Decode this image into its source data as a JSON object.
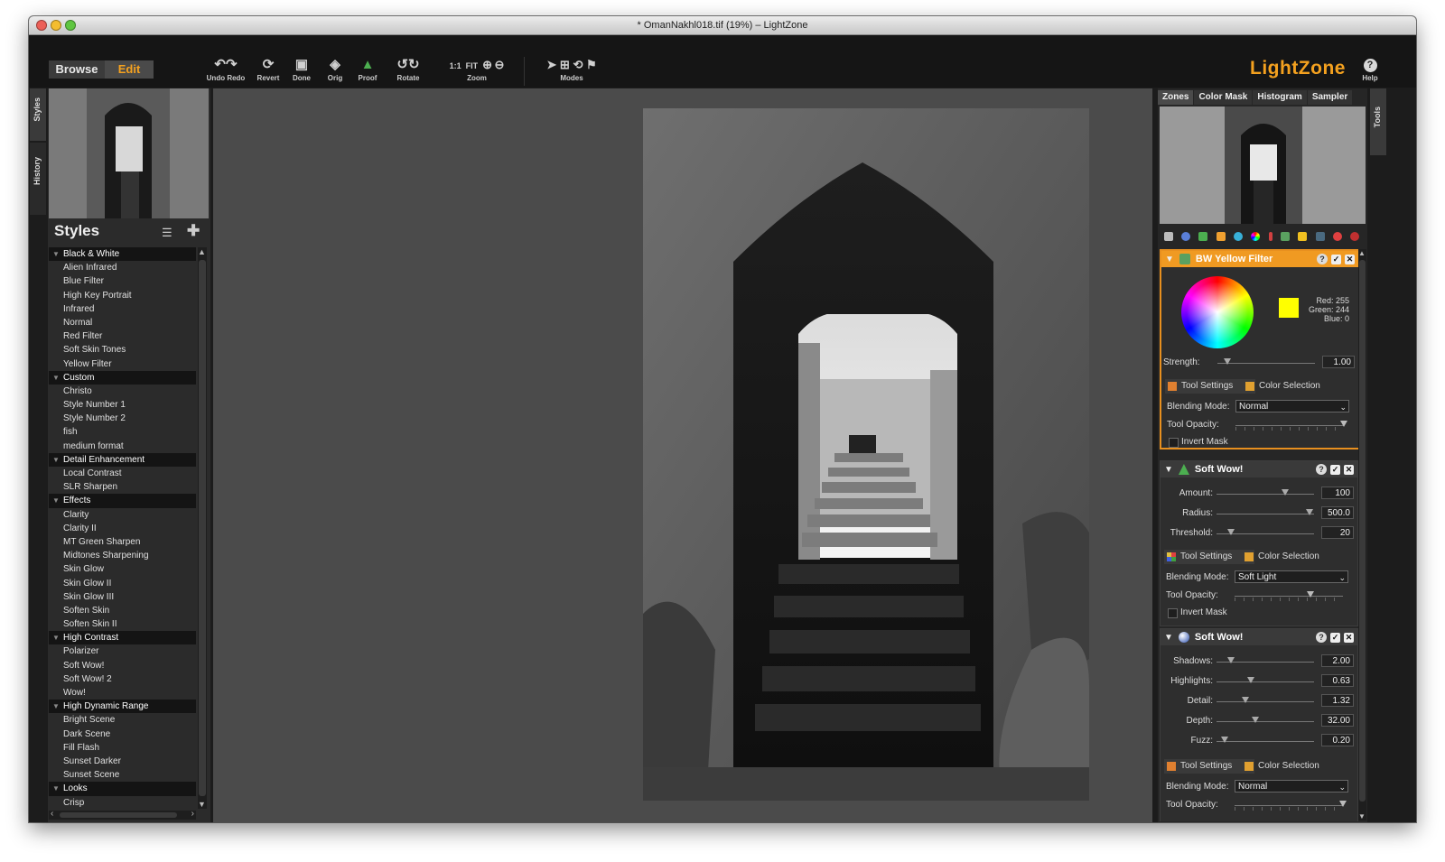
{
  "window": {
    "title": "* OmanNakhl018.tif (19%) – LightZone"
  },
  "toolbar": {
    "browse_label": "Browse",
    "edit_label": "Edit",
    "undo_redo_label": "Undo Redo",
    "revert_label": "Revert",
    "done_label": "Done",
    "orig_label": "Orig",
    "proof_label": "Proof",
    "rotate_label": "Rotate",
    "zoom_label": "Zoom",
    "zoom_1to1": "1:1",
    "zoom_fit": "FIT",
    "modes_label": "Modes",
    "logo": "LightZone",
    "help_label": "Help"
  },
  "left_tabs": {
    "styles": "Styles",
    "history": "History"
  },
  "right_tabs": {
    "tools": "Tools"
  },
  "styles_panel": {
    "title": "Styles",
    "items": [
      {
        "label": "Black & White",
        "group": true
      },
      {
        "label": "Alien Infrared"
      },
      {
        "label": "Blue Filter"
      },
      {
        "label": "High Key Portrait"
      },
      {
        "label": "Infrared"
      },
      {
        "label": "Normal"
      },
      {
        "label": "Red Filter"
      },
      {
        "label": "Soft Skin Tones"
      },
      {
        "label": "Yellow Filter"
      },
      {
        "label": "Custom",
        "group": true
      },
      {
        "label": "Christo"
      },
      {
        "label": "Style Number 1"
      },
      {
        "label": "Style Number 2"
      },
      {
        "label": "fish"
      },
      {
        "label": "medium format"
      },
      {
        "label": "Detail Enhancement",
        "group": true
      },
      {
        "label": "Local Contrast"
      },
      {
        "label": "SLR Sharpen"
      },
      {
        "label": "Effects",
        "group": true
      },
      {
        "label": "Clarity"
      },
      {
        "label": "Clarity II"
      },
      {
        "label": "MT Green Sharpen"
      },
      {
        "label": "Midtones Sharpening"
      },
      {
        "label": "Skin Glow"
      },
      {
        "label": "Skin Glow II"
      },
      {
        "label": "Skin Glow III"
      },
      {
        "label": "Soften Skin"
      },
      {
        "label": "Soften Skin II"
      },
      {
        "label": "High Contrast",
        "group": true
      },
      {
        "label": "Polarizer"
      },
      {
        "label": "Soft Wow!"
      },
      {
        "label": "Soft Wow! 2"
      },
      {
        "label": "Wow!"
      },
      {
        "label": "High Dynamic Range",
        "group": true
      },
      {
        "label": "Bright Scene"
      },
      {
        "label": "Dark Scene"
      },
      {
        "label": "Fill Flash"
      },
      {
        "label": "Sunset Darker"
      },
      {
        "label": "Sunset Scene"
      },
      {
        "label": "Looks",
        "group": true
      },
      {
        "label": "Crisp"
      }
    ]
  },
  "right_panel": {
    "tabs": [
      "Zones",
      "Color Mask",
      "Histogram",
      "Sampler"
    ],
    "bw_filter": {
      "title": "BW Yellow Filter",
      "red_label": "Red:",
      "red": "255",
      "green_label": "Green:",
      "green": "244",
      "blue_label": "Blue:",
      "blue": "0",
      "swatch_color": "#ffff00",
      "strength_label": "Strength:",
      "strength": "1.00",
      "strength_level": 0.1,
      "tab_tool_settings": "Tool Settings",
      "tab_color_selection": "Color Selection",
      "blending_label": "Blending Mode:",
      "blending": "Normal",
      "opacity_label": "Tool Opacity:",
      "opacity_level": 1.0,
      "invert_label": "Invert Mask"
    },
    "soft_wow_1": {
      "title": "Soft Wow!",
      "amount_label": "Amount:",
      "amount": "100",
      "amount_level": 0.7,
      "radius_label": "Radius:",
      "radius": "500.0",
      "radius_level": 0.95,
      "threshold_label": "Threshold:",
      "threshold": "20",
      "threshold_level": 0.15,
      "tab_tool_settings": "Tool Settings",
      "tab_color_selection": "Color Selection",
      "blending_label": "Blending Mode:",
      "blending": "Soft Light",
      "opacity_label": "Tool Opacity:",
      "opacity_level": 0.7,
      "invert_label": "Invert Mask"
    },
    "soft_wow_2": {
      "title": "Soft Wow!",
      "shadows_label": "Shadows:",
      "shadows": "2.00",
      "shadows_level": 0.15,
      "highlights_label": "Highlights:",
      "highlights": "0.63",
      "highlights_level": 0.35,
      "detail_label": "Detail:",
      "detail": "1.32",
      "detail_level": 0.3,
      "depth_label": "Depth:",
      "depth": "32.00",
      "depth_level": 0.4,
      "fuzz_label": "Fuzz:",
      "fuzz": "0.20",
      "fuzz_level": 0.08,
      "tab_tool_settings": "Tool Settings",
      "tab_color_selection": "Color Selection",
      "blending_label": "Blending Mode:",
      "blending": "Normal",
      "opacity_label": "Tool Opacity:",
      "opacity_level": 1.0
    }
  },
  "colors": {
    "accent": "#f09a22",
    "logo": "#f4a11f",
    "canvas": "#4b4b4b"
  }
}
